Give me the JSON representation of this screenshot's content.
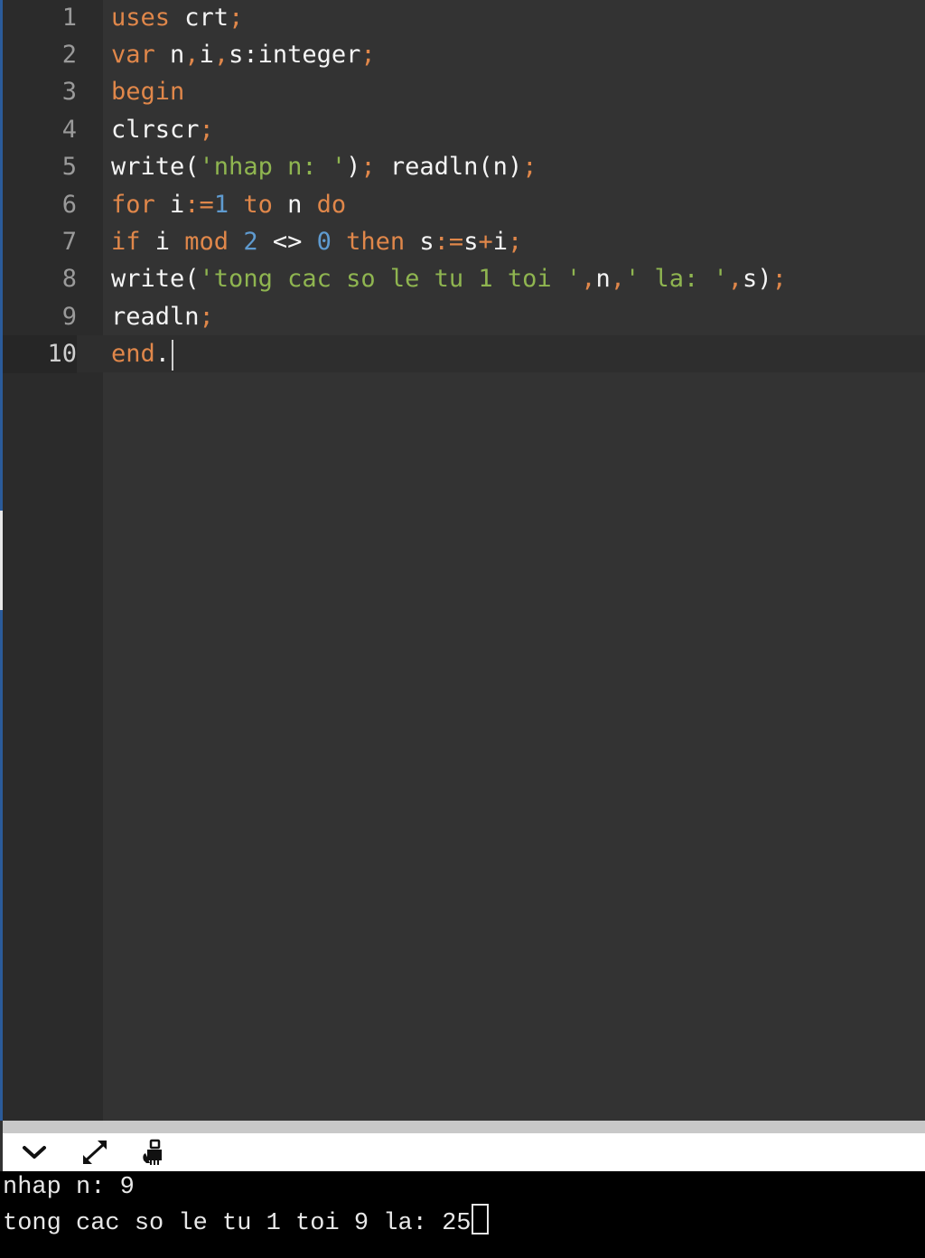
{
  "editor": {
    "active_line": 10,
    "lines": [
      {
        "number": "1",
        "tokens": [
          {
            "text": "uses",
            "kind": "kw"
          },
          {
            "text": " crt",
            "kind": "plain"
          },
          {
            "text": ";",
            "kind": "op"
          }
        ]
      },
      {
        "number": "2",
        "tokens": [
          {
            "text": "var",
            "kind": "kw"
          },
          {
            "text": " n",
            "kind": "plain"
          },
          {
            "text": ",",
            "kind": "op"
          },
          {
            "text": "i",
            "kind": "plain"
          },
          {
            "text": ",",
            "kind": "op"
          },
          {
            "text": "s:integer",
            "kind": "plain"
          },
          {
            "text": ";",
            "kind": "op"
          }
        ]
      },
      {
        "number": "3",
        "tokens": [
          {
            "text": "begin",
            "kind": "kw"
          }
        ]
      },
      {
        "number": "4",
        "tokens": [
          {
            "text": "clrscr",
            "kind": "plain"
          },
          {
            "text": ";",
            "kind": "op"
          }
        ]
      },
      {
        "number": "5",
        "tokens": [
          {
            "text": "write(",
            "kind": "plain"
          },
          {
            "text": "'nhap n: '",
            "kind": "str"
          },
          {
            "text": ")",
            "kind": "plain"
          },
          {
            "text": ";",
            "kind": "op"
          },
          {
            "text": " readln(n)",
            "kind": "plain"
          },
          {
            "text": ";",
            "kind": "op"
          }
        ]
      },
      {
        "number": "6",
        "tokens": [
          {
            "text": "for",
            "kind": "kw"
          },
          {
            "text": " i",
            "kind": "plain"
          },
          {
            "text": ":=",
            "kind": "op"
          },
          {
            "text": "1",
            "kind": "num"
          },
          {
            "text": " to",
            "kind": "kw"
          },
          {
            "text": " n",
            "kind": "plain"
          },
          {
            "text": " do",
            "kind": "kw"
          }
        ]
      },
      {
        "number": "7",
        "tokens": [
          {
            "text": "if",
            "kind": "kw"
          },
          {
            "text": " i",
            "kind": "plain"
          },
          {
            "text": " mod",
            "kind": "kw"
          },
          {
            "text": " 2",
            "kind": "num"
          },
          {
            "text": " <>",
            "kind": "plain"
          },
          {
            "text": " 0",
            "kind": "num"
          },
          {
            "text": " then",
            "kind": "kw"
          },
          {
            "text": " s",
            "kind": "plain"
          },
          {
            "text": ":=",
            "kind": "op"
          },
          {
            "text": "s",
            "kind": "plain"
          },
          {
            "text": "+",
            "kind": "op"
          },
          {
            "text": "i",
            "kind": "plain"
          },
          {
            "text": ";",
            "kind": "op"
          }
        ]
      },
      {
        "number": "8",
        "tokens": [
          {
            "text": "write(",
            "kind": "plain"
          },
          {
            "text": "'tong cac so le tu 1 toi '",
            "kind": "str"
          },
          {
            "text": ",",
            "kind": "op"
          },
          {
            "text": "n",
            "kind": "plain"
          },
          {
            "text": ",",
            "kind": "op"
          },
          {
            "text": "' la: '",
            "kind": "str"
          },
          {
            "text": ",",
            "kind": "op"
          },
          {
            "text": "s",
            "kind": "plain"
          },
          {
            "text": ")",
            "kind": "plain"
          },
          {
            "text": ";",
            "kind": "op"
          }
        ]
      },
      {
        "number": "9",
        "tokens": [
          {
            "text": "readln",
            "kind": "plain"
          },
          {
            "text": ";",
            "kind": "op"
          }
        ]
      },
      {
        "number": "10",
        "tokens": [
          {
            "text": "end",
            "kind": "kw"
          },
          {
            "text": ".",
            "kind": "plain"
          }
        ]
      }
    ]
  },
  "colors": {
    "editor_bg": "#333333",
    "gutter_bg": "#2b2b2b",
    "keyword": "#e0874a",
    "string": "#8fb550",
    "number": "#5f9bd0",
    "plain": "#f5f5f5",
    "console_bg": "#000000"
  },
  "console_toolbar": {
    "buttons": [
      {
        "name": "collapse-console-button",
        "icon": "chevron-down-icon"
      },
      {
        "name": "maximize-console-button",
        "icon": "expand-arrows-icon"
      },
      {
        "name": "clear-console-button",
        "icon": "clear-hand-icon"
      }
    ]
  },
  "console": {
    "lines": [
      "nhap n: 9",
      "tong cac so le tu 1 toi 9 la: 25"
    ]
  }
}
